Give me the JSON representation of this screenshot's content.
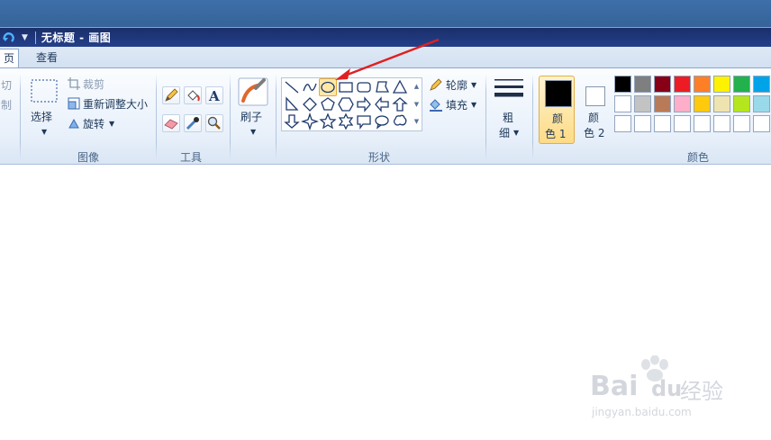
{
  "window": {
    "title": "无标题 - 画图"
  },
  "tabs": {
    "home": "页",
    "view": "查看"
  },
  "clipboard": {
    "cut": "切",
    "copy": "制"
  },
  "image_group": {
    "label": "图像",
    "select": "选择",
    "crop": "裁剪",
    "resize": "重新调整大小",
    "rotate": "旋转"
  },
  "tools_group": {
    "label": "工具"
  },
  "brush": {
    "label": "刷子"
  },
  "shapes_group": {
    "label": "形状",
    "outline": "轮廓",
    "fill": "填充"
  },
  "size": {
    "line1": "粗",
    "line2": "细"
  },
  "colors_group": {
    "label": "颜色",
    "color1_line1": "颜",
    "color1_line2": "色 1",
    "color2_line1": "颜",
    "color2_line2": "色 2",
    "color1_value": "#000000",
    "color2_value": "#ffffff",
    "palette_row1": [
      "#000000",
      "#7f7f7f",
      "#880015",
      "#ed1c24",
      "#ff7f27",
      "#fff200",
      "#22b14c",
      "#00a2e8"
    ],
    "palette_row2": [
      "#ffffff",
      "#c3c3c3",
      "#b97a57",
      "#ffaec9",
      "#ffc90e",
      "#efe4b0",
      "#b5e61d",
      "#99d9ea"
    ],
    "palette_row3": [
      "#ffffff",
      "#ffffff",
      "#ffffff",
      "#ffffff",
      "#ffffff",
      "#ffffff",
      "#ffffff",
      "#ffffff"
    ]
  },
  "annotation": {
    "arrow_color": "#e02020"
  },
  "watermark": {
    "brand": "Bai",
    "brand_suffix": "du",
    "cn": "经验",
    "url": "jingyan.baidu.com"
  }
}
